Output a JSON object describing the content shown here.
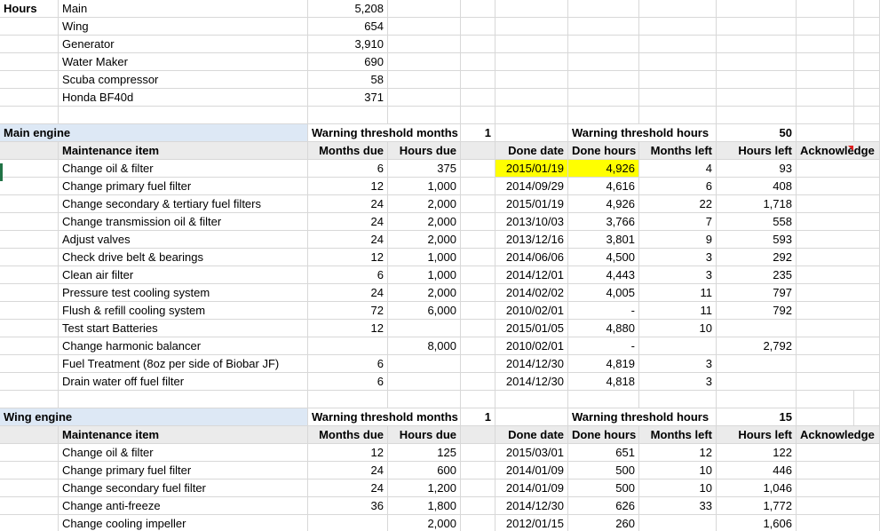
{
  "hours": {
    "label": "Hours",
    "items": [
      {
        "name": "Main",
        "value": "5,208"
      },
      {
        "name": "Wing",
        "value": "654"
      },
      {
        "name": "Generator",
        "value": "3,910"
      },
      {
        "name": "Water Maker",
        "value": "690"
      },
      {
        "name": "Scuba compressor",
        "value": "58"
      },
      {
        "name": "Honda BF40d",
        "value": "371"
      }
    ]
  },
  "sections": [
    {
      "title": "Main engine",
      "warn_months_label": "Warning threshold months",
      "warn_months": "1",
      "warn_hours_label": "Warning threshold hours",
      "warn_hours": "50",
      "headers": [
        "Maintenance item",
        "Months due",
        "Hours due",
        "Done date",
        "Done hours",
        "Months left",
        "Hours left",
        "Acknowledge"
      ],
      "rows": [
        [
          "Change oil & filter",
          "6",
          "375",
          "2015/01/19",
          "4,926",
          "4",
          "93",
          ""
        ],
        [
          "Change primary fuel filter",
          "12",
          "1,000",
          "2014/09/29",
          "4,616",
          "6",
          "408",
          ""
        ],
        [
          "Change secondary & tertiary fuel filters",
          "24",
          "2,000",
          "2015/01/19",
          "4,926",
          "22",
          "1,718",
          ""
        ],
        [
          "Change transmission oil & filter",
          "24",
          "2,000",
          "2013/10/03",
          "3,766",
          "7",
          "558",
          ""
        ],
        [
          "Adjust valves",
          "24",
          "2,000",
          "2013/12/16",
          "3,801",
          "9",
          "593",
          ""
        ],
        [
          "Check drive belt & bearings",
          "12",
          "1,000",
          "2014/06/06",
          "4,500",
          "3",
          "292",
          ""
        ],
        [
          "Clean air filter",
          "6",
          "1,000",
          "2014/12/01",
          "4,443",
          "3",
          "235",
          ""
        ],
        [
          "Pressure test cooling system",
          "24",
          "2,000",
          "2014/02/02",
          "4,005",
          "11",
          "797",
          ""
        ],
        [
          "Flush & refill cooling system",
          "72",
          "6,000",
          "2010/02/01",
          "-",
          "11",
          "792",
          ""
        ],
        [
          "Test start Batteries",
          "12",
          "",
          "2015/01/05",
          "4,880",
          "10",
          "",
          ""
        ],
        [
          "Change harmonic balancer",
          "",
          "8,000",
          "2010/02/01",
          "-",
          "",
          "2,792",
          ""
        ],
        [
          "Fuel Treatment (8oz per side of Biobar JF)",
          "6",
          "",
          "2014/12/30",
          "4,819",
          "3",
          "",
          ""
        ],
        [
          "Drain water off fuel filter",
          "6",
          "",
          "2014/12/30",
          "4,818",
          "3",
          "",
          ""
        ]
      ]
    },
    {
      "title": "Wing engine",
      "warn_months_label": "Warning threshold months",
      "warn_months": "1",
      "warn_hours_label": "Warning threshold hours",
      "warn_hours": "15",
      "headers": [
        "Maintenance item",
        "Months due",
        "Hours due",
        "Done date",
        "Done hours",
        "Months left",
        "Hours left",
        "Acknowledge"
      ],
      "rows": [
        [
          "Change oil & filter",
          "12",
          "125",
          "2015/03/01",
          "651",
          "12",
          "122",
          ""
        ],
        [
          "Change primary fuel filter",
          "24",
          "600",
          "2014/01/09",
          "500",
          "10",
          "446",
          ""
        ],
        [
          "Change secondary fuel filter",
          "24",
          "1,200",
          "2014/01/09",
          "500",
          "10",
          "1,046",
          ""
        ],
        [
          "Change anti-freeze",
          "36",
          "1,800",
          "2014/12/30",
          "626",
          "33",
          "1,772",
          ""
        ],
        [
          "Change cooling impeller",
          "",
          "2,000",
          "2012/01/15",
          "260",
          "",
          "1,606",
          ""
        ]
      ]
    }
  ],
  "colors": {
    "section_header_bg": "#dde8f5",
    "column_header_bg": "#ebebeb",
    "highlight": "#ffff00",
    "gridline": "#d8d8d8",
    "comment_marker": "#e02020"
  }
}
